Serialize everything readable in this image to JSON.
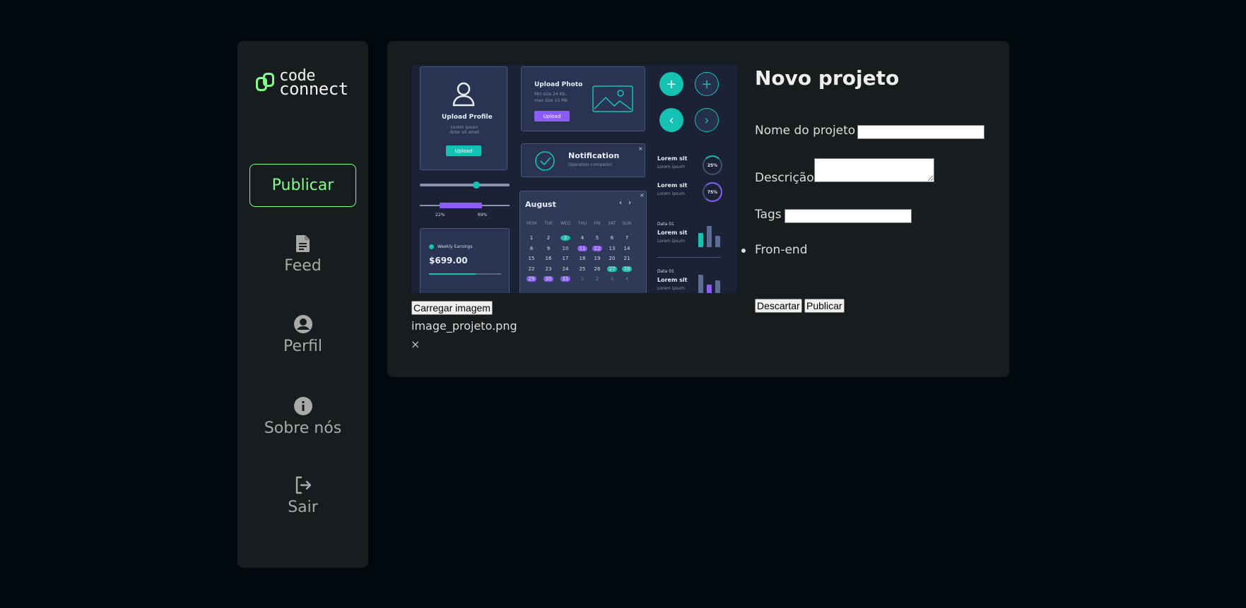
{
  "sidebar": {
    "logo": {
      "line1": "code",
      "line2": "connect"
    },
    "publish_label": "Publicar",
    "nav": [
      {
        "label": "Feed",
        "icon": "document-icon"
      },
      {
        "label": "Perfil",
        "icon": "account-circle-icon"
      },
      {
        "label": "Sobre nós",
        "icon": "info-icon"
      },
      {
        "label": "Sair",
        "icon": "logout-icon"
      }
    ]
  },
  "preview": {
    "upload_profile": {
      "title": "Upload Profile",
      "text": "Lorem ipsum dolor sit amet",
      "button": "Upload"
    },
    "upload_photo": {
      "title": "Upload Photo",
      "text1": "Min size 24 Kb,",
      "text2": "max size 15 Mb",
      "button": "Upload"
    },
    "notification": {
      "title": "Notification",
      "text": "Operation complete!"
    },
    "slider": {
      "low": "22%",
      "high": "69%",
      "low_value": 0.22,
      "high_value": 0.69
    },
    "earnings": {
      "title": "Weekly Earnings",
      "amount": "$699.00"
    },
    "calendar": {
      "month": "August",
      "weekdays": [
        "MON",
        "TUE",
        "WED",
        "THU",
        "FRI",
        "SAT",
        "SUN"
      ],
      "days": [
        "1",
        "2",
        "3",
        "4",
        "5",
        "6",
        "7",
        "8",
        "9",
        "10",
        "11",
        "12",
        "13",
        "14",
        "15",
        "16",
        "17",
        "18",
        "19",
        "20",
        "21",
        "22",
        "23",
        "24",
        "25",
        "26",
        "27",
        "28",
        "29",
        "30",
        "31",
        "1",
        "2",
        "3",
        "4"
      ]
    },
    "stats": [
      {
        "title": "Lorem sit",
        "sub": "Lorem ipsum",
        "value": "25%"
      },
      {
        "title": "Lorem sit",
        "sub": "Lorem ipsum",
        "value": "75%"
      }
    ],
    "data_cards": [
      {
        "label": "Data 01",
        "title": "Lorem sit",
        "sub": "Lorem ipsum"
      },
      {
        "label": "Data 01",
        "title": "Lorem sit",
        "sub": "Lorem ipsum"
      }
    ]
  },
  "upload": {
    "button_label": "Carregar imagem",
    "file_name": "image_projeto.png",
    "remove_symbol": "×"
  },
  "form": {
    "title": "Novo projeto",
    "name_label": "Nome do projeto",
    "name_value": "",
    "description_label": "Descrição",
    "description_value": "",
    "tags_label": "Tags",
    "tags_value": "",
    "tags": [
      "Fron-end"
    ],
    "discard_label": "Descartar",
    "publish_label": "Publicar"
  },
  "colors": {
    "accent": "#81fe88",
    "background": "#01080e",
    "surface": "#171d1f"
  }
}
